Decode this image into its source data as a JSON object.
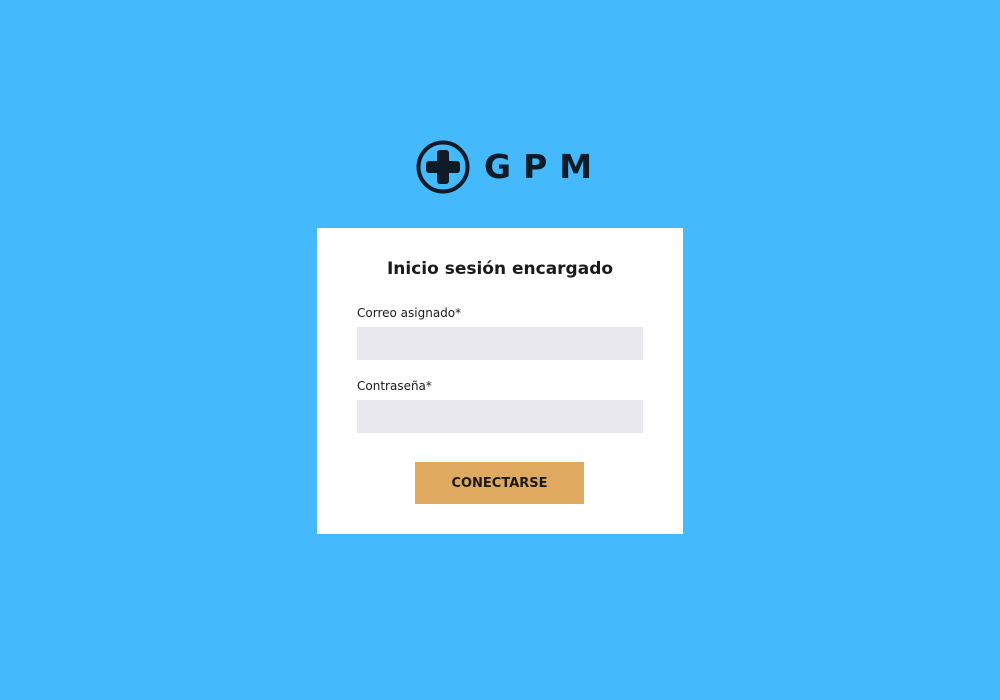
{
  "brand": {
    "name": "GPM",
    "icon": "medical-cross-icon",
    "color": "#0f1c28"
  },
  "login": {
    "title": "Inicio sesión encargado",
    "email_label": "Correo asignado*",
    "email_value": "",
    "password_label": "Contraseña*",
    "password_value": "",
    "submit_label": "CONECTARSE"
  },
  "colors": {
    "background": "#44b9fb",
    "card": "#ffffff",
    "input": "#e9e8ee",
    "button": "#dfaa5f"
  }
}
